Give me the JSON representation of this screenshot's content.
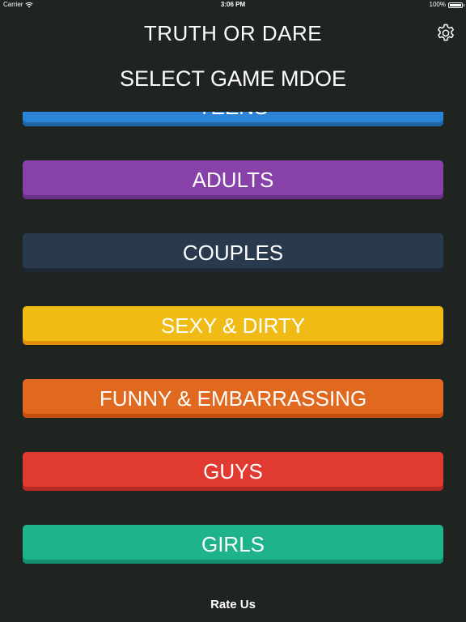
{
  "status_bar": {
    "carrier": "Carrier",
    "time": "3:06 PM",
    "battery": "100%",
    "battery_level": 1.0
  },
  "header": {
    "title": "TRUTH OR DARE",
    "subtitle": "SELECT GAME MDOE",
    "settings_icon": "gear-icon"
  },
  "modes": [
    {
      "label": "TEENS",
      "color": "#2b84d8",
      "shadow": "#1f63a6"
    },
    {
      "label": "ADULTS",
      "color": "#8841a8",
      "shadow": "#6a2f86"
    },
    {
      "label": "COUPLES",
      "color": "#2a3a4e",
      "shadow": "#1c2835"
    },
    {
      "label": "SEXY & DIRTY",
      "color": "#efbb14",
      "shadow": "#e08e0d"
    },
    {
      "label": "FUNNY & EMBARRASSING",
      "color": "#e0691f",
      "shadow": "#c14f10"
    },
    {
      "label": "GUYS",
      "color": "#e03a31",
      "shadow": "#b62a23"
    },
    {
      "label": "GIRLS",
      "color": "#1fb38c",
      "shadow": "#15906f"
    }
  ],
  "footer": {
    "rate_label": "Rate Us"
  }
}
